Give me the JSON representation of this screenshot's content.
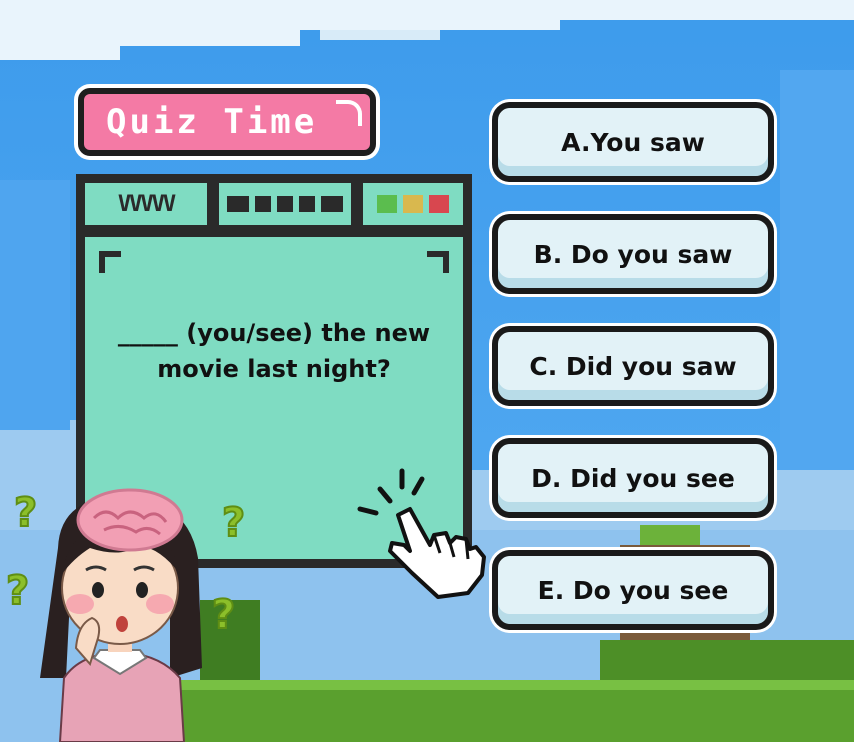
{
  "quiz": {
    "title": "Quiz Time",
    "question": "_____ (you/see) the new movie last night?"
  },
  "options": [
    {
      "label": "A.You saw"
    },
    {
      "label": "B. Do you saw"
    },
    {
      "label": "C. Did you saw"
    },
    {
      "label": "D. Did you see"
    },
    {
      "label": "E. Do you see"
    }
  ],
  "toolbar": {
    "zigzag": "VVVVV",
    "status_colors": [
      "#5bbd4e",
      "#d9b84e",
      "#d8474f"
    ]
  },
  "colors": {
    "title_bg": "#f47aa5",
    "window_bg": "#7fdcc2",
    "option_bg": "#e2f2f7",
    "outline": "#1a1a1a"
  },
  "icons": [
    "hand-pointer-icon",
    "question-mark-icon",
    "thinking-girl-illustration"
  ]
}
